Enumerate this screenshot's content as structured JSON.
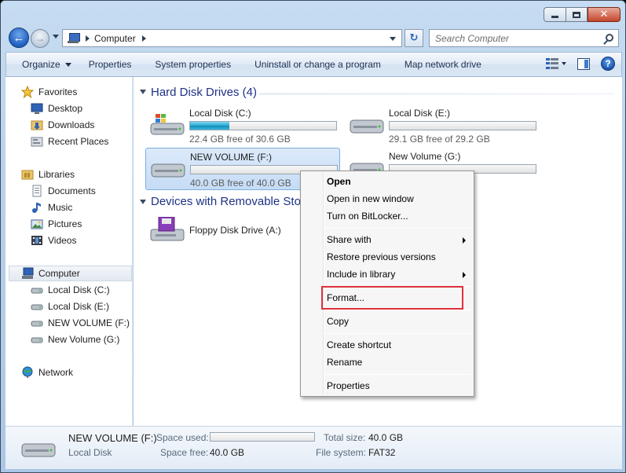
{
  "window": {
    "caption_buttons": [
      "minimize",
      "maximize",
      "close"
    ]
  },
  "address": {
    "location": "Computer",
    "search_placeholder": "Search Computer"
  },
  "toolbar": {
    "organize": "Organize",
    "properties": "Properties",
    "system_properties": "System properties",
    "uninstall": "Uninstall or change a program",
    "map_drive": "Map network drive"
  },
  "nav": {
    "favorites": "Favorites",
    "desktop": "Desktop",
    "downloads": "Downloads",
    "recent": "Recent Places",
    "libraries": "Libraries",
    "documents": "Documents",
    "music": "Music",
    "pictures": "Pictures",
    "videos": "Videos",
    "computer": "Computer",
    "drive_c": "Local Disk (C:)",
    "drive_e": "Local Disk (E:)",
    "drive_f": "NEW VOLUME (F:)",
    "drive_g": "New Volume (G:)",
    "network": "Network"
  },
  "content": {
    "hdd_title": "Hard Disk Drives (4)",
    "removable_title": "Devices with Removable Stor",
    "drives": [
      {
        "name": "Local Disk (C:)",
        "free": "22.4 GB free of 30.6 GB",
        "used_fraction": 0.27
      },
      {
        "name": "Local Disk (E:)",
        "free": "29.1 GB free of 29.2 GB",
        "used_fraction": 0.0
      },
      {
        "name": "NEW VOLUME (F:)",
        "free": "40.0 GB free of 40.0 GB",
        "used_fraction": 0.0
      },
      {
        "name": "New Volume (G:)",
        "free": "",
        "used_fraction": 0.0
      }
    ],
    "floppy": "Floppy Disk Drive (A:)"
  },
  "context_menu": {
    "open": "Open",
    "open_new": "Open in new window",
    "bitlocker": "Turn on BitLocker...",
    "share": "Share with",
    "restore": "Restore previous versions",
    "include": "Include in library",
    "format": "Format...",
    "copy": "Copy",
    "shortcut": "Create shortcut",
    "rename": "Rename",
    "properties": "Properties"
  },
  "details": {
    "name": "NEW VOLUME (F:)",
    "type": "Local Disk",
    "space_used_label": "Space used:",
    "space_free_label": "Space free:",
    "space_free": "40.0 GB",
    "total_label": "Total size:",
    "total": "40.0 GB",
    "fs_label": "File system:",
    "fs": "FAT32"
  },
  "colors": {
    "group_title": "#1e3287",
    "highlight": "#e0323c",
    "selection": "#c5dcf5"
  }
}
